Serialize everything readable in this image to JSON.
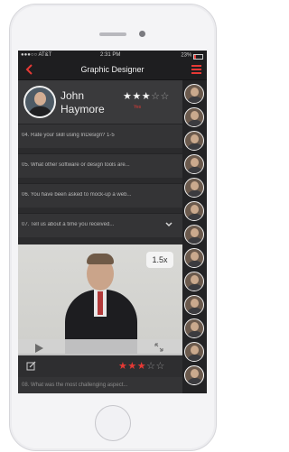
{
  "status_bar": {
    "carrier": "●●●○○ AT&T",
    "time": "2:31 PM",
    "battery": "23%"
  },
  "nav": {
    "title": "Graphic Designer",
    "back_icon": "chevron-left-icon",
    "menu_icon": "hamburger-icon",
    "accent": "#e53935"
  },
  "candidate": {
    "first_name": "John",
    "last_name": "Haymore",
    "stars_filled": "★★★",
    "stars_empty": "☆☆",
    "rating": 3.5,
    "badge": "Yes"
  },
  "questions": [
    {
      "text": "04. Rate your skill using InDesign? 1-5"
    },
    {
      "text": "05. What other software or design tools are..."
    },
    {
      "text": "06. You have been asked to mock-up a web..."
    },
    {
      "text": "07. Tell us about a time you received..."
    }
  ],
  "video": {
    "speed": "1.5x",
    "play_icon": "play-icon",
    "expand_icon": "expand-icon"
  },
  "answer_rating": {
    "filled": "★★★",
    "empty": "☆☆",
    "value": 3
  },
  "next_question": "08. What was the most challenging aspect..."
}
